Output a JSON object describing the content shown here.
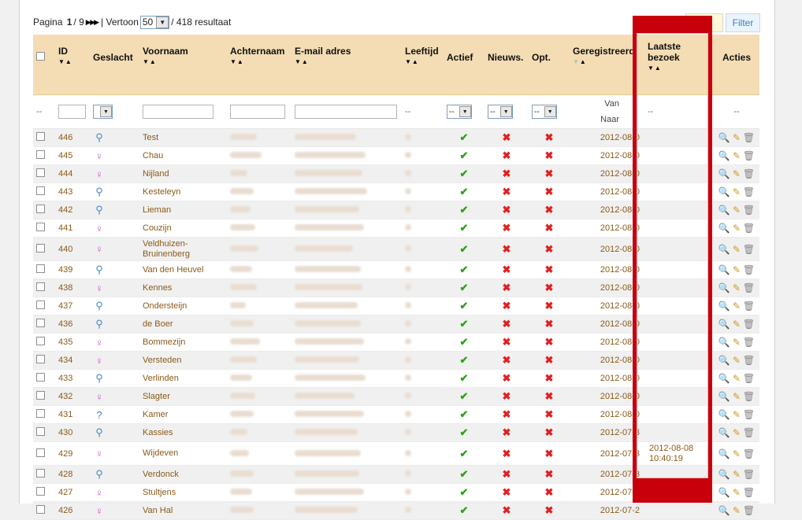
{
  "pager": {
    "prefix": "Pagina",
    "current": "1",
    "sep": "/",
    "total": "9",
    "nav": "▶ ▶▶",
    "show_label": "| Vertoon",
    "per_page": "50",
    "result_text": "/ 418 resultaat"
  },
  "buttons": {
    "reset": "et",
    "filter": "Filter"
  },
  "columns": {
    "id": "ID",
    "gender": "Geslacht",
    "first": "Voornaam",
    "last": "Achternaam",
    "email": "E-mail adres",
    "age": "Leeftijd",
    "active": "Actief",
    "news": "Nieuws.",
    "opt": "Opt.",
    "registered": "Geregistreerd",
    "last_visit": "Laatste bezoek",
    "actions": "Acties"
  },
  "filters": {
    "dash": "--",
    "select": "--",
    "van": "Van",
    "naar": "Naar"
  },
  "rows": [
    {
      "id": "446",
      "g": "m",
      "name": "Test",
      "active": true,
      "news": false,
      "opt": false,
      "reg": "2012-08-0",
      "visit": ""
    },
    {
      "id": "445",
      "g": "f",
      "name": "Chau",
      "active": true,
      "news": false,
      "opt": false,
      "reg": "2012-08-0",
      "visit": ""
    },
    {
      "id": "444",
      "g": "f",
      "name": "Nijland",
      "active": true,
      "news": false,
      "opt": false,
      "reg": "2012-08-0",
      "visit": ""
    },
    {
      "id": "443",
      "g": "m",
      "name": "Kesteleyn",
      "active": true,
      "news": false,
      "opt": false,
      "reg": "2012-08-0",
      "visit": ""
    },
    {
      "id": "442",
      "g": "m",
      "name": "Lieman",
      "active": true,
      "news": false,
      "opt": false,
      "reg": "2012-08-0",
      "visit": ""
    },
    {
      "id": "441",
      "g": "f",
      "name": "Couzijn",
      "active": true,
      "news": false,
      "opt": false,
      "reg": "2012-08-0",
      "visit": ""
    },
    {
      "id": "440",
      "g": "f",
      "name": "Veldhuizen-Bruinenberg",
      "active": true,
      "news": false,
      "opt": false,
      "reg": "2012-08-0",
      "visit": ""
    },
    {
      "id": "439",
      "g": "m",
      "name": "Van den Heuvel",
      "active": true,
      "news": false,
      "opt": false,
      "reg": "2012-08-0",
      "visit": ""
    },
    {
      "id": "438",
      "g": "f",
      "name": "Kennes",
      "active": true,
      "news": false,
      "opt": false,
      "reg": "2012-08-0",
      "visit": ""
    },
    {
      "id": "437",
      "g": "m",
      "name": "Ondersteijn",
      "active": true,
      "news": false,
      "opt": false,
      "reg": "2012-08-0",
      "visit": ""
    },
    {
      "id": "436",
      "g": "m",
      "name": "de Boer",
      "active": true,
      "news": false,
      "opt": false,
      "reg": "2012-08-0",
      "visit": ""
    },
    {
      "id": "435",
      "g": "f",
      "name": "Bommezijn",
      "active": true,
      "news": false,
      "opt": false,
      "reg": "2012-08-0",
      "visit": ""
    },
    {
      "id": "434",
      "g": "f",
      "name": "Versteden",
      "active": true,
      "news": false,
      "opt": false,
      "reg": "2012-08-0",
      "visit": ""
    },
    {
      "id": "433",
      "g": "m",
      "name": "Verlinden",
      "active": true,
      "news": false,
      "opt": false,
      "reg": "2012-08-0",
      "visit": ""
    },
    {
      "id": "432",
      "g": "f",
      "name": "Slagter",
      "active": true,
      "news": false,
      "opt": false,
      "reg": "2012-08-0",
      "visit": ""
    },
    {
      "id": "431",
      "g": "u",
      "name": "Kamer",
      "active": true,
      "news": false,
      "opt": false,
      "reg": "2012-08-0",
      "visit": ""
    },
    {
      "id": "430",
      "g": "m",
      "name": "Kassies",
      "active": true,
      "news": false,
      "opt": false,
      "reg": "2012-07-3",
      "visit": ""
    },
    {
      "id": "429",
      "g": "f",
      "name": "Wijdeven",
      "active": true,
      "news": false,
      "opt": false,
      "reg": "2012-07-3",
      "visit": "2012-08-08 10:40:19"
    },
    {
      "id": "428",
      "g": "m",
      "name": "Verdonck",
      "active": true,
      "news": false,
      "opt": false,
      "reg": "2012-07-3",
      "visit": ""
    },
    {
      "id": "427",
      "g": "f",
      "name": "Stultjens",
      "active": true,
      "news": false,
      "opt": false,
      "reg": "2012-07-2",
      "visit": ""
    },
    {
      "id": "426",
      "g": "f",
      "name": "Van Hal",
      "active": true,
      "news": false,
      "opt": false,
      "reg": "2012-07-2",
      "visit": ""
    }
  ],
  "colors": {
    "header_bg": "#f4ddb4",
    "highlight": "#c8000b",
    "link": "#8a5a1a"
  }
}
